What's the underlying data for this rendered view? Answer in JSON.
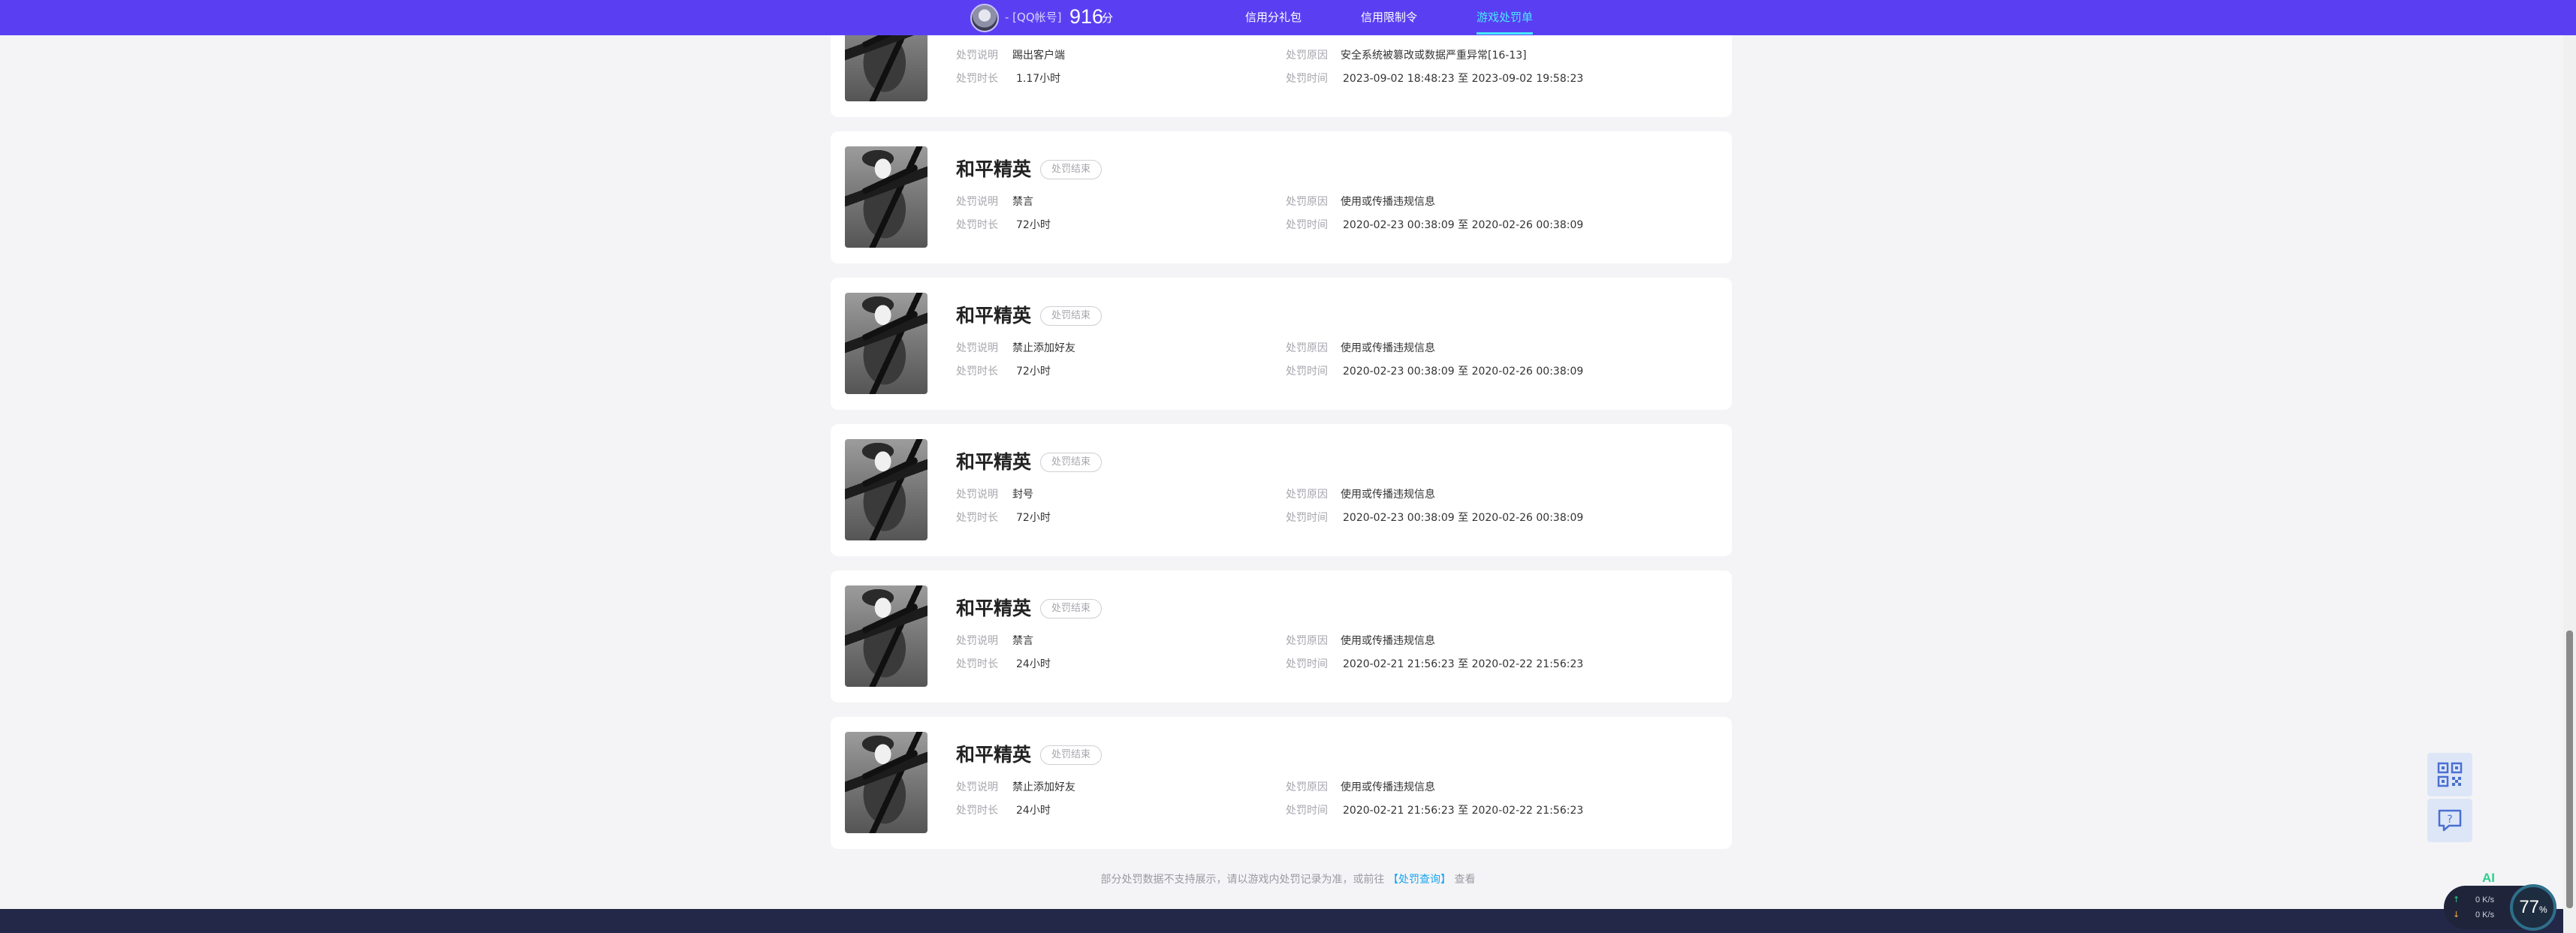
{
  "header": {
    "account_label": "- [QQ帐号]",
    "score": "916",
    "score_unit": "分",
    "nav": [
      {
        "label": "信用分礼包",
        "active": false
      },
      {
        "label": "信用限制令",
        "active": false
      },
      {
        "label": "游戏处罚单",
        "active": true
      }
    ]
  },
  "labels": {
    "desc": "处罚说明",
    "duration": "处罚时长",
    "reason": "处罚原因",
    "time": "处罚时间"
  },
  "records": [
    {
      "game": "",
      "status": "",
      "desc": "踢出客户端",
      "duration": "1.17小时",
      "reason": "安全系统被篡改或数据严重异常[16-13]",
      "time": "2023-09-02 18:48:23 至 2023-09-02 19:58:23"
    },
    {
      "game": "和平精英",
      "status": "处罚结束",
      "desc": "禁言",
      "duration": "72小时",
      "reason": "使用或传播违规信息",
      "time": "2020-02-23 00:38:09 至 2020-02-26 00:38:09"
    },
    {
      "game": "和平精英",
      "status": "处罚结束",
      "desc": "禁止添加好友",
      "duration": "72小时",
      "reason": "使用或传播违规信息",
      "time": "2020-02-23 00:38:09 至 2020-02-26 00:38:09"
    },
    {
      "game": "和平精英",
      "status": "处罚结束",
      "desc": "封号",
      "duration": "72小时",
      "reason": "使用或传播违规信息",
      "time": "2020-02-23 00:38:09 至 2020-02-26 00:38:09"
    },
    {
      "game": "和平精英",
      "status": "处罚结束",
      "desc": "禁言",
      "duration": "24小时",
      "reason": "使用或传播违规信息",
      "time": "2020-02-21 21:56:23 至 2020-02-22 21:56:23"
    },
    {
      "game": "和平精英",
      "status": "处罚结束",
      "desc": "禁止添加好友",
      "duration": "24小时",
      "reason": "使用或传播违规信息",
      "time": "2020-02-21 21:56:23 至 2020-02-22 21:56:23"
    }
  ],
  "footer": {
    "note_prefix": "部分处罚数据不支持展示，请以游戏内处罚记录为准，或前往",
    "link": "【处罚查询】",
    "note_suffix": "查看"
  },
  "tools": {
    "qr_icon": "qr-code-icon",
    "feedback_icon": "feedback-icon",
    "ai_label": "AI",
    "upload_speed": "0 K/s",
    "download_speed": "0 K/s",
    "upload_arrow_color": "#2fcf8e",
    "download_arrow_color": "#f5b23d",
    "percent": "77",
    "percent_unit": "%"
  }
}
